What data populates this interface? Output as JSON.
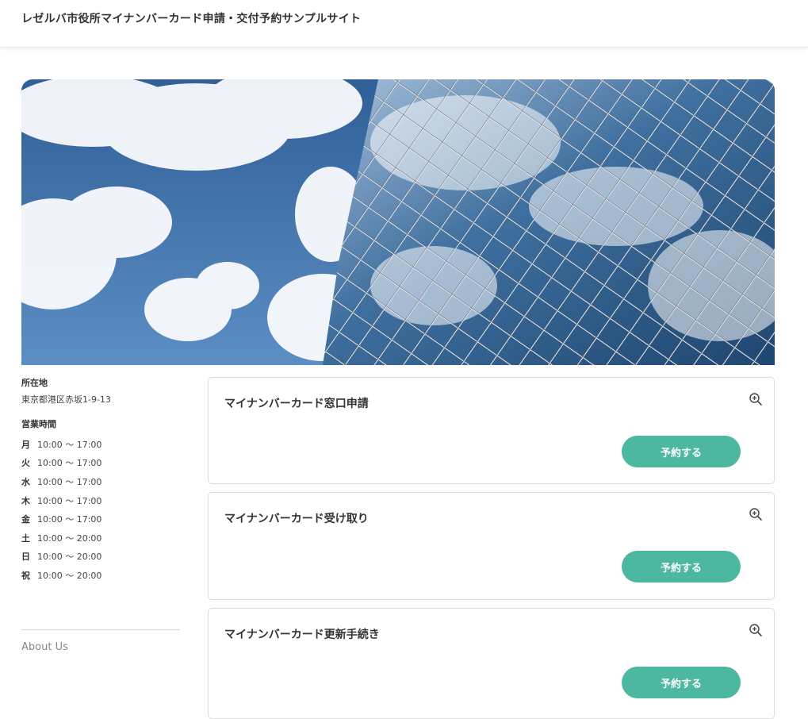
{
  "header": {
    "title": "レゼルバ市役所マイナンバーカード申請・交付予約サンプルサイト"
  },
  "sidebar": {
    "location_heading": "所在地",
    "address": "東京都港区赤坂1-9-13",
    "hours_heading": "営業時間",
    "hours": [
      {
        "day": "月",
        "time": "10:00 〜 17:00"
      },
      {
        "day": "火",
        "time": "10:00 〜 17:00"
      },
      {
        "day": "水",
        "time": "10:00 〜 17:00"
      },
      {
        "day": "木",
        "time": "10:00 〜 17:00"
      },
      {
        "day": "金",
        "time": "10:00 〜 17:00"
      },
      {
        "day": "土",
        "time": "10:00 〜 20:00"
      },
      {
        "day": "日",
        "time": "10:00 〜 20:00"
      },
      {
        "day": "祝",
        "time": "10:00 〜 20:00"
      }
    ],
    "about_link": "About Us"
  },
  "plans": [
    {
      "title": "マイナンバーカード窓口申請",
      "button": "予約する",
      "icon": "zoom-in-icon"
    },
    {
      "title": "マイナンバーカード受け取り",
      "button": "予約する",
      "icon": "zoom-in-icon"
    },
    {
      "title": "マイナンバーカード更新手続き",
      "button": "予約する",
      "icon": "zoom-in-icon"
    }
  ],
  "colors": {
    "accent": "#4db8a0",
    "card_border": "#dcdcdc",
    "text": "#333333"
  }
}
